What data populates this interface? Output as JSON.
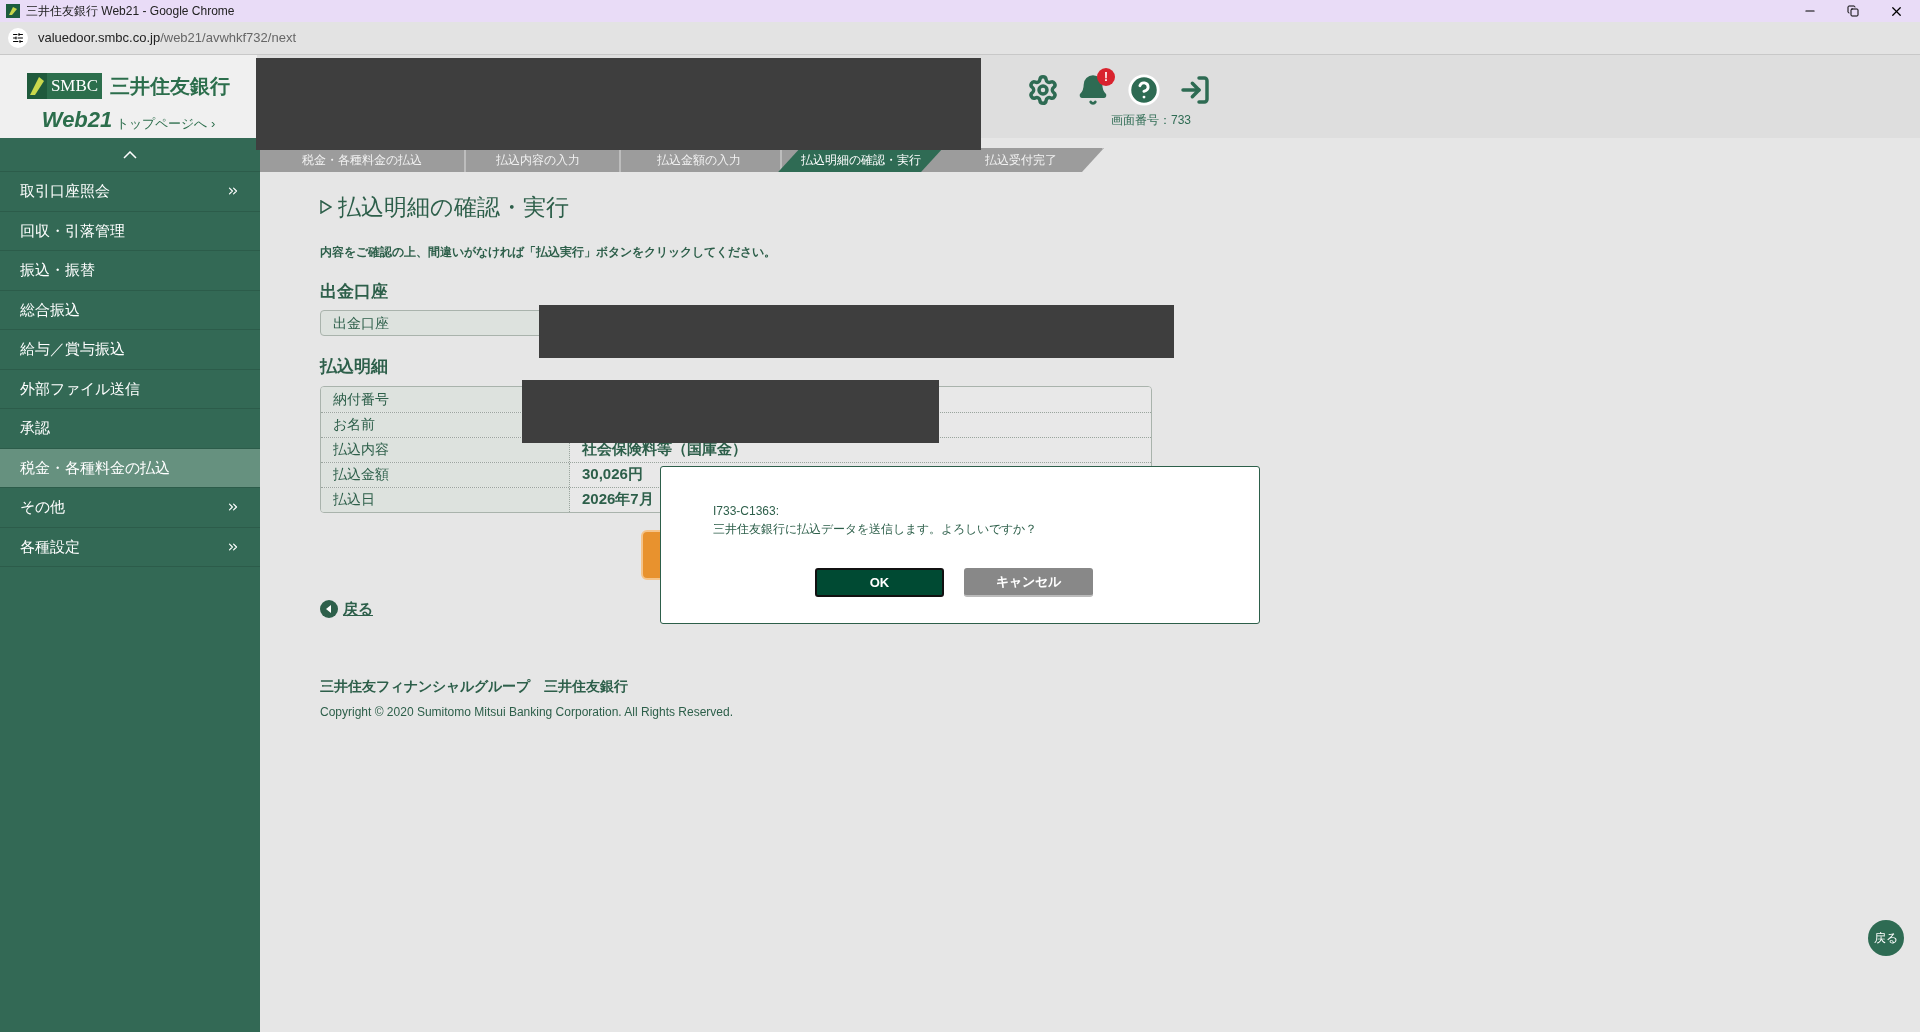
{
  "browser": {
    "title": "三井住友銀行 Web21 - Google Chrome",
    "url_host": "valuedoor.smbc.co.jp",
    "url_path": "/web21/avwhkf732/next"
  },
  "header": {
    "logo_text": "SMBC",
    "bank_name": "三井住友銀行",
    "web21": "Web21",
    "top_link": "トップページへ ›",
    "notification_badge": "!",
    "screen_number": "画面番号：733"
  },
  "sidebar": {
    "items": [
      {
        "label": "取引口座照会",
        "has_submenu": true,
        "selected": false
      },
      {
        "label": "回収・引落管理",
        "has_submenu": false,
        "selected": false
      },
      {
        "label": "振込・振替",
        "has_submenu": false,
        "selected": false
      },
      {
        "label": "総合振込",
        "has_submenu": false,
        "selected": false
      },
      {
        "label": "給与／賞与振込",
        "has_submenu": false,
        "selected": false
      },
      {
        "label": "外部ファイル送信",
        "has_submenu": false,
        "selected": false
      },
      {
        "label": "承認",
        "has_submenu": false,
        "selected": false
      },
      {
        "label": "税金・各種料金の払込",
        "has_submenu": false,
        "selected": true
      },
      {
        "label": "その他",
        "has_submenu": true,
        "selected": false
      },
      {
        "label": "各種設定",
        "has_submenu": true,
        "selected": false
      }
    ]
  },
  "steps": [
    {
      "label": "税金・各種料金の払込",
      "selected": false
    },
    {
      "label": "払込内容の入力",
      "selected": false
    },
    {
      "label": "払込金額の入力",
      "selected": false
    },
    {
      "label": "払込明細の確認・実行",
      "selected": true
    },
    {
      "label": "払込受付完了",
      "selected": false
    }
  ],
  "page": {
    "title": "払込明細の確認・実行",
    "instruction": "内容をご確認の上、間違いがなければ「払込実行」ボタンをクリックしてください。",
    "account_section": {
      "title": "出金口座",
      "label": "出金口座"
    },
    "details_section": {
      "title": "払込明細",
      "rows": [
        {
          "label": "納付番号"
        },
        {
          "label": "お名前"
        },
        {
          "label": "払込内容",
          "value": "社会保険料等（国庫金）"
        },
        {
          "label": "払込金額",
          "value": "30,026円"
        },
        {
          "label": "払込日",
          "value": "2026年7月"
        }
      ]
    },
    "back_link": "戻る"
  },
  "footer": {
    "group": "三井住友フィナンシャルグループ　三井住友銀行",
    "copyright": "Copyright © 2020 Sumitomo Mitsui Banking Corporation. All Rights Reserved."
  },
  "dialog": {
    "code": "I733-C1363:",
    "message": "三井住友銀行に払込データを送信します。よろしいですか？",
    "buttons": [
      {
        "label": "OK",
        "kind": "primary"
      },
      {
        "label": "キャンセル",
        "kind": "secondary"
      }
    ]
  },
  "floating_back": "戻る"
}
